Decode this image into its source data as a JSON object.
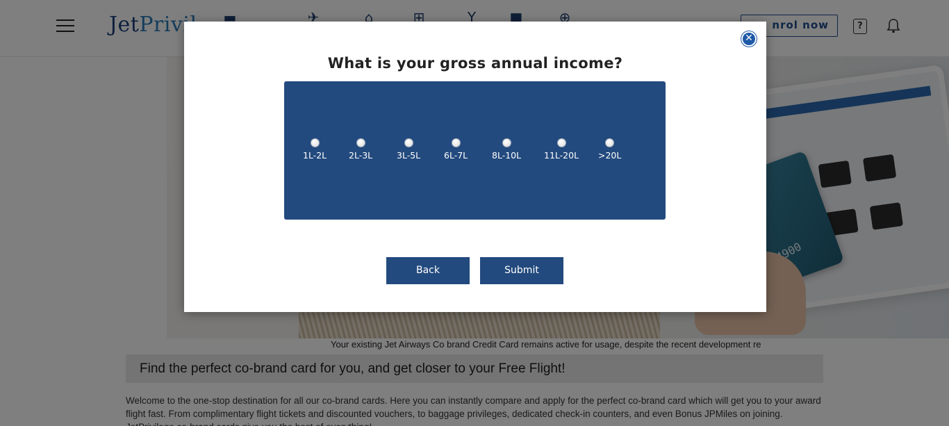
{
  "header": {
    "logo_text_a": "Jet",
    "logo_text_b": "Privil",
    "enrol_label": "nrol now",
    "help_label": "?",
    "nav_icons": [
      "card-icon",
      "plane-icon",
      "lock-icon",
      "cart-icon",
      "cocktail-icon",
      "chat-icon",
      "plus-circle-icon"
    ]
  },
  "ticker": {
    "text": "Your existing Jet Airways Co brand Credit Card remains active for usage, despite the recent development re"
  },
  "find": {
    "heading": "Find the perfect co-brand card for you, and get closer to your Free Flight!"
  },
  "welcome": {
    "text": "Welcome to the one-stop destination for all our co-brand cards. Here you can instantly compare and apply for the perfect co-brand card which will get you to your award flight fast. From complimentary flight tickets and discounted vouchers, to baggage privileges, dedicated check-in counters, and even Bonus JPMiles on joining. JetPrivilege co-brand cards give you the best of everything!"
  },
  "hero": {
    "card_number": "4900"
  },
  "modal": {
    "title": "What is your gross annual income?",
    "close_symbol": "✕",
    "options": [
      "1L-2L",
      "2L-3L",
      "3L-5L",
      "6L-7L",
      "8L-10L",
      "11L-20L",
      ">20L"
    ],
    "back_label": "Back",
    "submit_label": "Submit",
    "panel_color": "#234a7e",
    "accent_color": "#1f5aa8"
  }
}
